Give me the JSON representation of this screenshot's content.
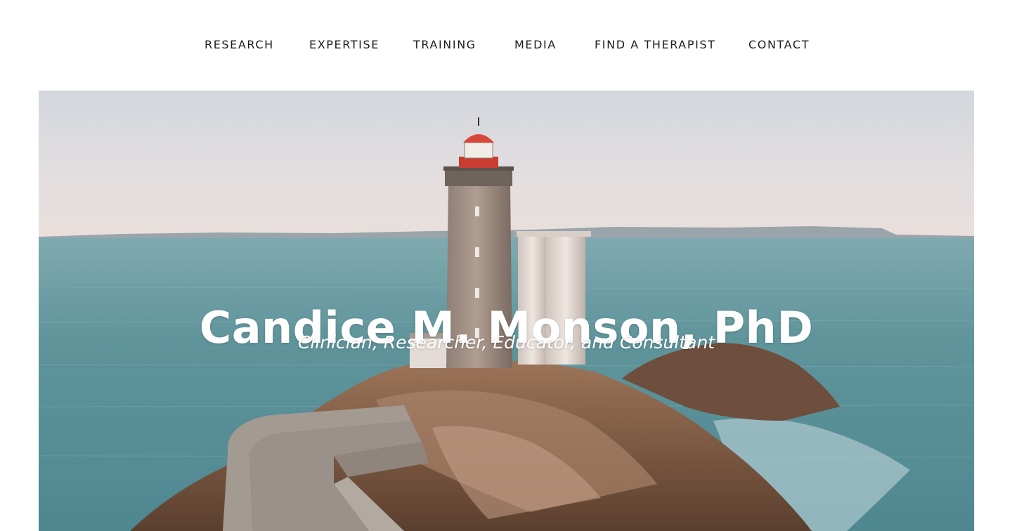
{
  "nav": {
    "items": [
      {
        "label": "RESEARCH"
      },
      {
        "label": "EXPERTISE"
      },
      {
        "label": "TRAINING"
      },
      {
        "label": "MEDIA"
      },
      {
        "label": "FIND A THERAPIST"
      },
      {
        "label": "CONTACT"
      }
    ]
  },
  "hero": {
    "title": "Candice M. Monson, PhD",
    "subtitle": "Clinician, Researcher, Educator, and Consultant",
    "image_subject": "lighthouse-on-rocky-island-photo"
  },
  "colors": {
    "nav_text": "#1c1c1c",
    "page_background": "#ffffff",
    "hero_text": "#ffffff",
    "sea": "#5f949b",
    "sky": "#dcdde2",
    "lighthouse_cap": "#d9473a"
  }
}
